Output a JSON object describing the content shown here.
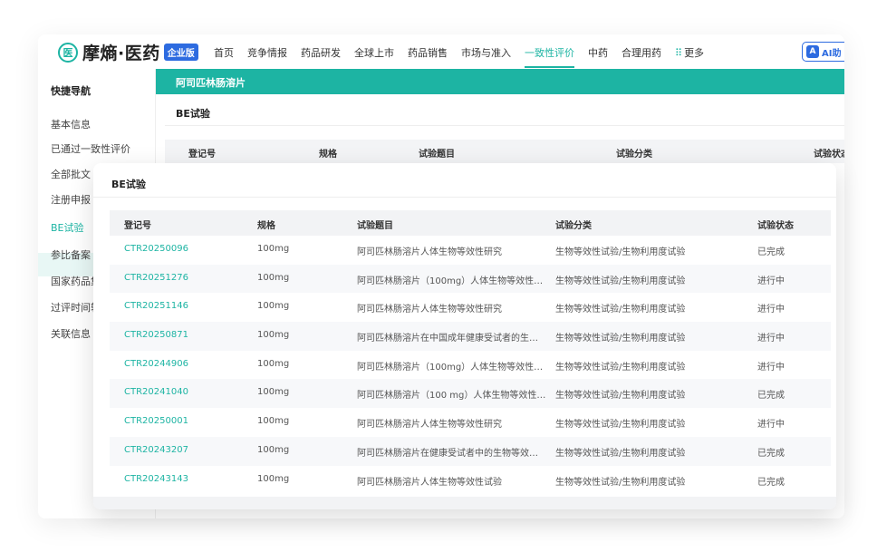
{
  "brand": {
    "name": "摩熵·医药",
    "badge": "企业版",
    "mark": "医"
  },
  "nav": {
    "items": [
      "首页",
      "竞争情报",
      "药品研发",
      "全球上市",
      "药品销售",
      "市场与准入",
      "一致性评价",
      "中药",
      "合理用药"
    ],
    "more": "更多",
    "ai_label": "AI助"
  },
  "sidebar": {
    "title": "快捷导航",
    "items": [
      "基本信息",
      "已通过一致性评价",
      "全部批文",
      "注册申报",
      "BE试验",
      "参比备案",
      "国家药品集",
      "过评时间轴",
      "关联信息"
    ]
  },
  "drug": {
    "name": "阿司匹林肠溶片"
  },
  "section": {
    "title": "BE试验"
  },
  "table": {
    "headers": [
      "登记号",
      "规格",
      "试验题目",
      "试验分类",
      "试验状态"
    ],
    "rows": [
      [
        "CTR20250096",
        "100mg",
        "阿司匹林肠溶片人体生物等效性研究",
        "生物等效性试验/生物利用度试验",
        "已完成"
      ],
      [
        "CTR20251276",
        "100mg",
        "阿司匹林肠溶片（100mg）人体生物等效性…",
        "生物等效性试验/生物利用度试验",
        "进行中"
      ],
      [
        "CTR20251146",
        "100mg",
        "阿司匹林肠溶片人体生物等效性研究",
        "生物等效性试验/生物利用度试验",
        "进行中"
      ],
      [
        "CTR20250871",
        "100mg",
        "阿司匹林肠溶片在中国成年健康受试者的生…",
        "生物等效性试验/生物利用度试验",
        "进行中"
      ],
      [
        "CTR20244906",
        "100mg",
        "阿司匹林肠溶片（100mg）人体生物等效性…",
        "生物等效性试验/生物利用度试验",
        "进行中"
      ],
      [
        "CTR20241040",
        "100mg",
        "阿司匹林肠溶片（100 mg）人体生物等效性…",
        "生物等效性试验/生物利用度试验",
        "已完成"
      ],
      [
        "CTR20250001",
        "100mg",
        "阿司匹林肠溶片人体生物等效性研究",
        "生物等效性试验/生物利用度试验",
        "进行中"
      ],
      [
        "CTR20243207",
        "100mg",
        "阿司匹林肠溶片在健康受试者中的生物等效…",
        "生物等效性试验/生物利用度试验",
        "已完成"
      ],
      [
        "CTR20243143",
        "100mg",
        "阿司匹林肠溶片人体生物等效性试验",
        "生物等效性试验/生物利用度试验",
        "已完成"
      ]
    ]
  },
  "colors": {
    "accent": "#1db4a3",
    "badge": "#2d6be0"
  }
}
